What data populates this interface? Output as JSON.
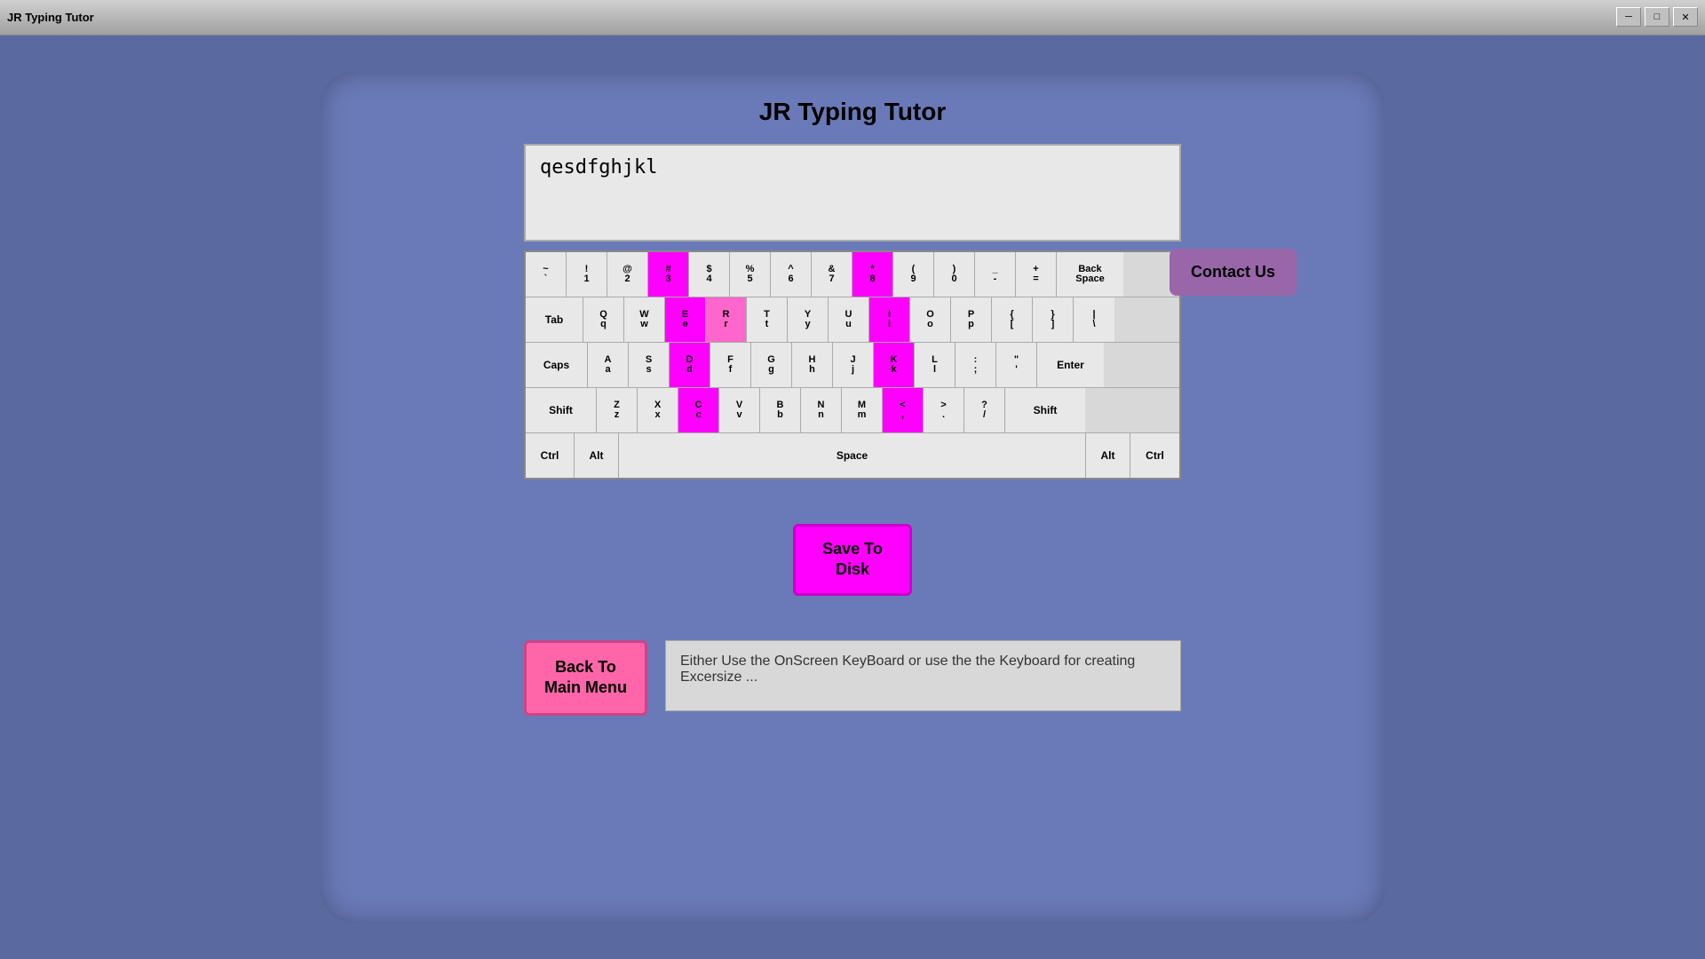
{
  "titleBar": {
    "title": "JR Typing Tutor",
    "minimize": "─",
    "maximize": "□",
    "close": "✕"
  },
  "appTitle": "JR Typing Tutor",
  "textInput": {
    "value": "qesdfghjkl",
    "placeholder": ""
  },
  "contactUs": "Contact Us",
  "keyboard": {
    "rows": [
      [
        {
          "top": "~",
          "bottom": "`",
          "style": "normal"
        },
        {
          "top": "!",
          "bottom": "1",
          "style": "normal"
        },
        {
          "top": "@",
          "bottom": "2",
          "style": "normal"
        },
        {
          "top": "#",
          "bottom": "3",
          "style": "magenta"
        },
        {
          "top": "$",
          "bottom": "4",
          "style": "normal"
        },
        {
          "top": "%",
          "bottom": "5",
          "style": "normal"
        },
        {
          "top": "^",
          "bottom": "6",
          "style": "normal"
        },
        {
          "top": "&",
          "bottom": "7",
          "style": "normal"
        },
        {
          "top": "*",
          "bottom": "8",
          "style": "magenta"
        },
        {
          "top": "(",
          "bottom": "9",
          "style": "normal"
        },
        {
          "top": ")",
          "bottom": "0",
          "style": "normal"
        },
        {
          "top": "_",
          "bottom": "-",
          "style": "normal"
        },
        {
          "top": "+",
          "bottom": "=",
          "style": "normal"
        },
        {
          "top": "Back",
          "bottom": "Space",
          "style": "special backspace"
        }
      ],
      [
        {
          "top": "Tab",
          "bottom": "",
          "style": "special tab"
        },
        {
          "top": "Q",
          "bottom": "q",
          "style": "normal"
        },
        {
          "top": "W",
          "bottom": "w",
          "style": "normal"
        },
        {
          "top": "E",
          "bottom": "e",
          "style": "magenta"
        },
        {
          "top": "R",
          "bottom": "r",
          "style": "pink"
        },
        {
          "top": "T",
          "bottom": "t",
          "style": "normal"
        },
        {
          "top": "Y",
          "bottom": "y",
          "style": "normal"
        },
        {
          "top": "U",
          "bottom": "u",
          "style": "normal"
        },
        {
          "top": "I",
          "bottom": "i",
          "style": "magenta"
        },
        {
          "top": "O",
          "bottom": "o",
          "style": "normal"
        },
        {
          "top": "P",
          "bottom": "p",
          "style": "normal"
        },
        {
          "top": "{",
          "bottom": "[",
          "style": "normal"
        },
        {
          "top": "}",
          "bottom": "]",
          "style": "normal"
        },
        {
          "top": "|",
          "bottom": "\\",
          "style": "normal"
        }
      ],
      [
        {
          "top": "Caps",
          "bottom": "",
          "style": "special caps"
        },
        {
          "top": "A",
          "bottom": "a",
          "style": "normal"
        },
        {
          "top": "S",
          "bottom": "s",
          "style": "normal"
        },
        {
          "top": "D",
          "bottom": "d",
          "style": "magenta"
        },
        {
          "top": "F",
          "bottom": "f",
          "style": "normal"
        },
        {
          "top": "G",
          "bottom": "g",
          "style": "normal"
        },
        {
          "top": "H",
          "bottom": "h",
          "style": "normal"
        },
        {
          "top": "J",
          "bottom": "j",
          "style": "normal"
        },
        {
          "top": "K",
          "bottom": "k",
          "style": "magenta"
        },
        {
          "top": "L",
          "bottom": "l",
          "style": "normal"
        },
        {
          "top": ":",
          "bottom": ";",
          "style": "normal"
        },
        {
          "top": "\"",
          "bottom": "'",
          "style": "normal"
        },
        {
          "top": "Enter",
          "bottom": "",
          "style": "special enter"
        }
      ],
      [
        {
          "top": "Shift",
          "bottom": "",
          "style": "special shift-left"
        },
        {
          "top": "Z",
          "bottom": "z",
          "style": "normal"
        },
        {
          "top": "X",
          "bottom": "x",
          "style": "normal"
        },
        {
          "top": "C",
          "bottom": "c",
          "style": "magenta"
        },
        {
          "top": "V",
          "bottom": "v",
          "style": "normal"
        },
        {
          "top": "B",
          "bottom": "b",
          "style": "normal"
        },
        {
          "top": "N",
          "bottom": "n",
          "style": "normal"
        },
        {
          "top": "M",
          "bottom": "m",
          "style": "normal"
        },
        {
          "top": "<",
          "bottom": ",",
          "style": "magenta"
        },
        {
          "top": ">",
          "bottom": ".",
          "style": "normal"
        },
        {
          "top": "?",
          "bottom": "/",
          "style": "normal"
        },
        {
          "top": "Shift",
          "bottom": "",
          "style": "special shift-right"
        }
      ],
      [
        {
          "top": "Ctrl",
          "bottom": "",
          "style": "special ctrl"
        },
        {
          "top": "Alt",
          "bottom": "",
          "style": "special alt"
        },
        {
          "top": "Space",
          "bottom": "",
          "style": "special widest"
        },
        {
          "top": "Alt",
          "bottom": "",
          "style": "special alt"
        },
        {
          "top": "Ctrl",
          "bottom": "",
          "style": "special ctrl"
        }
      ]
    ]
  },
  "saveToDisk": "Save To\nDisk",
  "backToMainMenu": "Back To\nMain Menu",
  "infoText": "Either Use the OnScreen KeyBoard or use the the Keyboard for creating Excersize ..."
}
